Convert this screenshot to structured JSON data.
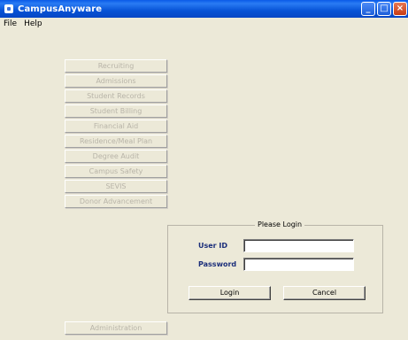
{
  "window": {
    "title": "CampusAnyware",
    "controls": {
      "minimize": "_",
      "maximize": "□",
      "close": "×"
    }
  },
  "menu": {
    "items": [
      {
        "label": "File"
      },
      {
        "label": "Help"
      }
    ]
  },
  "modules": {
    "items": [
      {
        "label": "Recruiting"
      },
      {
        "label": "Admissions"
      },
      {
        "label": "Student Records"
      },
      {
        "label": "Student Billing"
      },
      {
        "label": "Financial Aid"
      },
      {
        "label": "Residence/Meal Plan"
      },
      {
        "label": "Degree Audit"
      },
      {
        "label": "Campus Safety"
      },
      {
        "label": "SEVIS"
      },
      {
        "label": "Donor Advancement"
      }
    ],
    "administration": "Administration"
  },
  "login": {
    "title": "Please Login",
    "user_id_label": "User ID",
    "password_label": "Password",
    "user_id_value": "",
    "password_value": "",
    "login_button": "Login",
    "cancel_button": "Cancel"
  }
}
